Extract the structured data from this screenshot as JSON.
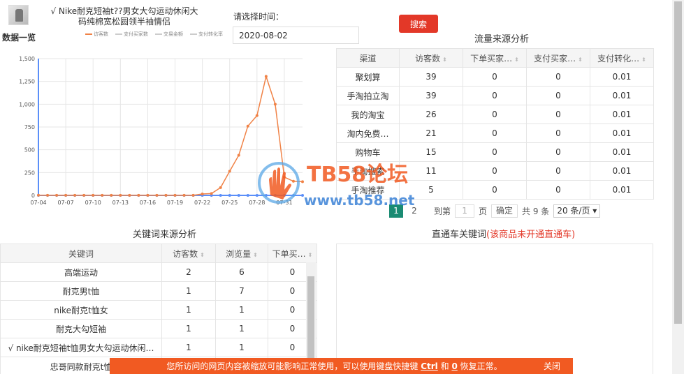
{
  "product": {
    "title_line1": "√ Nike耐克短袖t??男女大勾运动休闲大",
    "title_line2": "码纯棉宽松圆领半袖情侣"
  },
  "filter": {
    "time_label": "请选择时间：",
    "date_value": "2020-08-02",
    "search_label": "搜索"
  },
  "overview": {
    "title": "数据一览",
    "legend": [
      "访客数",
      "支付买家数",
      "交易金额",
      "支付转化率"
    ]
  },
  "chart_data": {
    "type": "line",
    "title": "",
    "xlabel": "",
    "ylabel": "",
    "ylim": [
      0,
      1500
    ],
    "yticks": [
      "0",
      "250",
      "500",
      "750",
      "1,000",
      "1,250",
      "1,500"
    ],
    "xticks": [
      "07-04",
      "07-07",
      "07-10",
      "07-13",
      "07-16",
      "07-19",
      "07-22",
      "07-25",
      "07-28",
      "07-31"
    ],
    "x": [
      "07-04",
      "07-05",
      "07-06",
      "07-07",
      "07-08",
      "07-09",
      "07-10",
      "07-11",
      "07-12",
      "07-13",
      "07-14",
      "07-15",
      "07-16",
      "07-17",
      "07-18",
      "07-19",
      "07-20",
      "07-21",
      "07-22",
      "07-23",
      "07-24",
      "07-25",
      "07-26",
      "07-27",
      "07-28",
      "07-29",
      "07-30",
      "07-31",
      "08-01",
      "08-02"
    ],
    "series": [
      {
        "name": "访客数",
        "color": "#f08246",
        "values": [
          2,
          1,
          1,
          1,
          1,
          1,
          1,
          1,
          1,
          1,
          1,
          1,
          1,
          1,
          1,
          1,
          1,
          1,
          15,
          20,
          85,
          265,
          440,
          760,
          875,
          1305,
          1000,
          200,
          155,
          150
        ]
      },
      {
        "name": "支付买家数",
        "color": "#5b8ff9",
        "values": [
          0,
          0,
          0,
          0,
          0,
          0,
          0,
          0,
          0,
          0,
          0,
          0,
          0,
          0,
          0,
          0,
          0,
          0,
          0,
          0,
          0,
          0,
          0,
          0,
          0,
          0,
          0,
          0,
          0,
          0
        ]
      }
    ]
  },
  "flow": {
    "title": "流量来源分析",
    "columns": [
      "渠道",
      "访客数",
      "下单买家…",
      "支付买家…",
      "支付转化…"
    ],
    "rows": [
      [
        "聚划算",
        "39",
        "0",
        "0",
        "0.01"
      ],
      [
        "手淘拍立淘",
        "39",
        "0",
        "0",
        "0.01"
      ],
      [
        "我的淘宝",
        "26",
        "0",
        "0",
        "0.01"
      ],
      [
        "淘内免费…",
        "21",
        "0",
        "0",
        "0.01"
      ],
      [
        "购物车",
        "15",
        "0",
        "0",
        "0.01"
      ],
      [
        "手淘搜索",
        "11",
        "0",
        "0",
        "0.01"
      ],
      [
        "手淘推荐",
        "5",
        "0",
        "0",
        "0.01"
      ]
    ],
    "pager": {
      "pages": [
        "1",
        "2"
      ],
      "goto_label": "到第",
      "goto_value": "1",
      "page_unit": "页",
      "confirm": "确定",
      "total": "共 9 条",
      "page_size": "20 条/页"
    }
  },
  "keywords": {
    "title": "关键词来源分析",
    "columns": [
      "关键词",
      "访客数",
      "浏览量",
      "下单买…"
    ],
    "rows": [
      [
        "高端运动",
        "2",
        "6",
        "0"
      ],
      [
        "耐克男t恤",
        "1",
        "7",
        "0"
      ],
      [
        "nike耐克t恤女",
        "1",
        "1",
        "0"
      ],
      [
        "耐克大勾短袖",
        "1",
        "1",
        "0"
      ],
      [
        "√ nike耐克短袖t恤男女大勾运动休闲…",
        "1",
        "1",
        "0"
      ],
      [
        "忠哥同款耐克t恤",
        "",
        "",
        ""
      ]
    ]
  },
  "ztc": {
    "title": "直通车关键词",
    "warning": "(该商品未开通直通车)"
  },
  "watermark": {
    "brand": "TB58论坛",
    "url": "www.tb58.net"
  },
  "notice": {
    "prefix": "您所访问的网页内容被缩放可能影响正常使用，可以使用键盘快捷键",
    "key1": "Ctrl",
    "mid": "和",
    "key2": "0",
    "suffix": "恢复正常。",
    "close": "关闭"
  }
}
